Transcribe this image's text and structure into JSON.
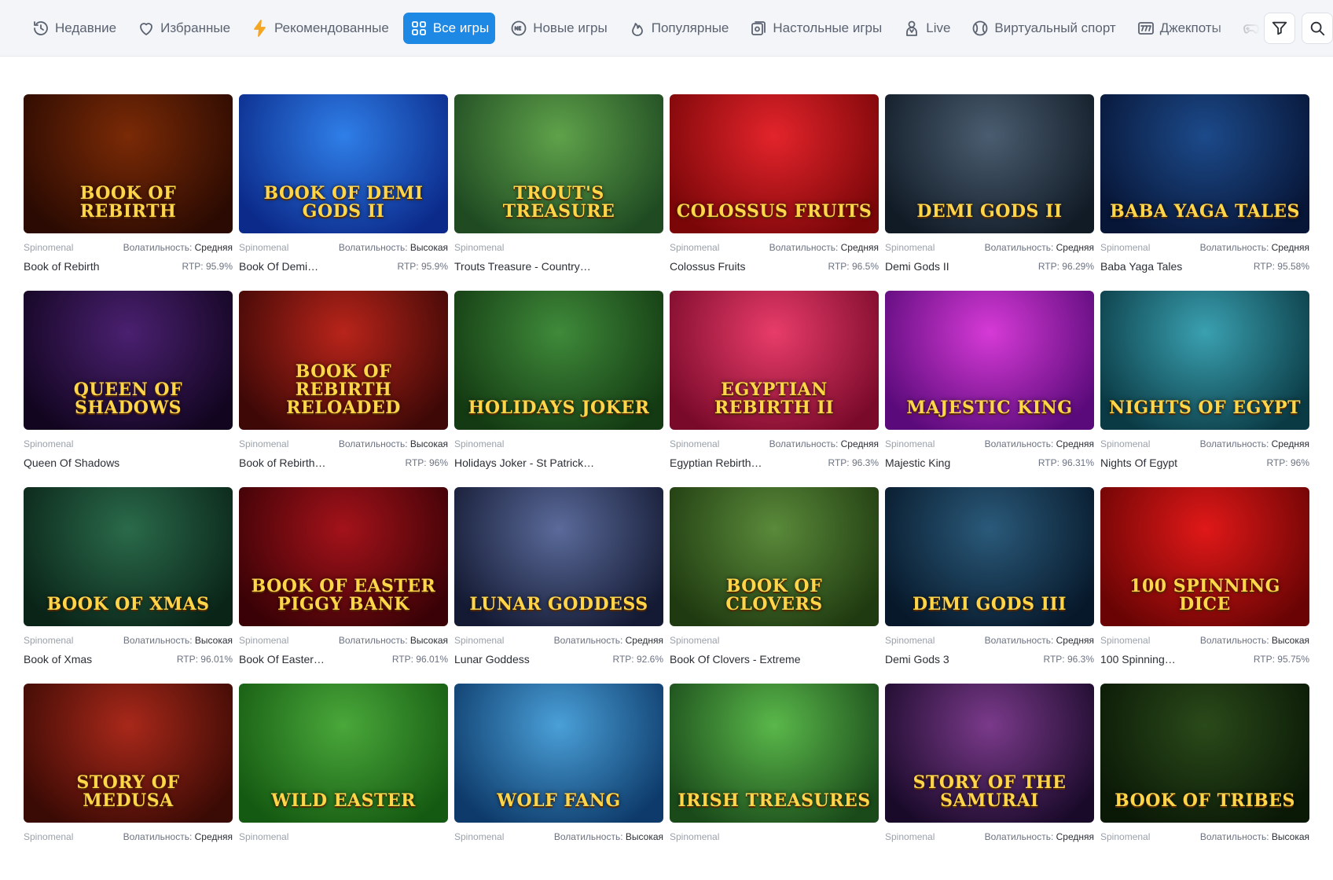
{
  "nav": {
    "tabs": [
      {
        "label": "Недавние",
        "icon": "history-icon"
      },
      {
        "label": "Избранные",
        "icon": "heart-icon"
      },
      {
        "label": "Рекомендованные",
        "icon": "lightning-icon"
      },
      {
        "label": "Все игры",
        "icon": "grid-icon",
        "active": true
      },
      {
        "label": "Новые игры",
        "icon": "new-badge-icon"
      },
      {
        "label": "Популярные",
        "icon": "flame-icon"
      },
      {
        "label": "Настольные игры",
        "icon": "chip-icon"
      },
      {
        "label": "Live",
        "icon": "dealer-icon"
      },
      {
        "label": "Виртуальный спорт",
        "icon": "ball-icon"
      },
      {
        "label": "Джекпоты",
        "icon": "777-icon"
      },
      {
        "label": "Други",
        "icon": "gamepad-icon"
      }
    ],
    "filter_icon": "filter-icon",
    "search_icon": "search-icon"
  },
  "labels": {
    "volatility": "Волатильность: ",
    "rtp": "RTP: "
  },
  "games": [
    {
      "title": "Book of Rebirth",
      "art": "BOOK OF REBIRTH",
      "provider": "Spinomenal",
      "volatility": "Средняя",
      "rtp": "95.9%",
      "colors": [
        "#7a2a06",
        "#2a0a02"
      ]
    },
    {
      "title": "Book Of Demi…",
      "art": "BOOK OF DEMI GODS II",
      "provider": "Spinomenal",
      "volatility": "Высокая",
      "rtp": "95.9%",
      "colors": [
        "#2f7fe8",
        "#0b2a8a"
      ]
    },
    {
      "title": "Trouts Treasure - Countryside Quest",
      "art": "TROUT'S TREASURE",
      "provider": "Spinomenal",
      "volatility": "",
      "rtp": "",
      "colors": [
        "#5fa24a",
        "#1f4a22"
      ]
    },
    {
      "title": "Colossus Fruits",
      "art": "COLOSSUS FRUITS",
      "provider": "Spinomenal",
      "volatility": "Средняя",
      "rtp": "96.5%",
      "colors": [
        "#e3242b",
        "#7a0608"
      ]
    },
    {
      "title": "Demi Gods II",
      "art": "DEMI GODS II",
      "provider": "Spinomenal",
      "volatility": "Средняя",
      "rtp": "96.29%",
      "colors": [
        "#4a5d70",
        "#111b26"
      ]
    },
    {
      "title": "Baba Yaga Tales",
      "art": "BABA YAGA TALES",
      "provider": "Spinomenal",
      "volatility": "Средняя",
      "rtp": "95.58%",
      "colors": [
        "#1c4a8a",
        "#071536"
      ]
    },
    {
      "title": "Queen Of Shadows",
      "art": "QUEEN OF SHADOWS",
      "provider": "Spinomenal",
      "volatility": "",
      "rtp": "",
      "colors": [
        "#4a2070",
        "#120520"
      ]
    },
    {
      "title": "Book of Rebirth…",
      "art": "BOOK OF REBIRTH RELOADED",
      "provider": "Spinomenal",
      "volatility": "Высокая",
      "rtp": "96%",
      "colors": [
        "#b8241a",
        "#3d0806"
      ]
    },
    {
      "title": "Holidays Joker - St Patricks Day",
      "art": "HOLIDAYS JOKER",
      "provider": "Spinomenal",
      "volatility": "",
      "rtp": "",
      "colors": [
        "#3f8a3a",
        "#133a12"
      ]
    },
    {
      "title": "Egyptian Rebirth…",
      "art": "EGYPTIAN REBIRTH II",
      "provider": "Spinomenal",
      "volatility": "Средняя",
      "rtp": "96.3%",
      "colors": [
        "#e83c6a",
        "#7a0a2a"
      ]
    },
    {
      "title": "Majestic King",
      "art": "MAJESTIC KING",
      "provider": "Spinomenal",
      "volatility": "Средняя",
      "rtp": "96.31%",
      "colors": [
        "#d63ad6",
        "#5a0a7a"
      ]
    },
    {
      "title": "Nights Of Egypt",
      "art": "NIGHTS OF EGYPT",
      "provider": "Spinomenal",
      "volatility": "Средняя",
      "rtp": "96%",
      "colors": [
        "#3aa0b0",
        "#0a3a44"
      ]
    },
    {
      "title": "Book of Xmas",
      "art": "BOOK OF XMAS",
      "provider": "Spinomenal",
      "volatility": "Высокая",
      "rtp": "96.01%",
      "colors": [
        "#2a6a4a",
        "#0a2418"
      ]
    },
    {
      "title": "Book Of Easter…",
      "art": "BOOK OF EASTER PIGGY BANK",
      "provider": "Spinomenal",
      "volatility": "Высокая",
      "rtp": "96.01%",
      "colors": [
        "#a4121a",
        "#3a0206"
      ]
    },
    {
      "title": "Lunar Goddess",
      "art": "LUNAR GODDESS",
      "provider": "Spinomenal",
      "volatility": "Средняя",
      "rtp": "92.6%",
      "colors": [
        "#5a6a9a",
        "#141a33"
      ]
    },
    {
      "title": "Book Of Clovers - Extreme",
      "art": "BOOK OF CLOVERS",
      "provider": "Spinomenal",
      "volatility": "",
      "rtp": "",
      "colors": [
        "#5a8a3a",
        "#1f3a10"
      ]
    },
    {
      "title": "Demi Gods 3",
      "art": "DEMI GODS III",
      "provider": "Spinomenal",
      "volatility": "Средняя",
      "rtp": "96.3%",
      "colors": [
        "#2a5a7a",
        "#07182a"
      ]
    },
    {
      "title": "100 Spinning…",
      "art": "100 SPINNING DICE",
      "provider": "Spinomenal",
      "volatility": "Высокая",
      "rtp": "95.75%",
      "colors": [
        "#e01818",
        "#6a0404"
      ]
    },
    {
      "title": "",
      "art": "STORY OF MEDUSA",
      "provider": "Spinomenal",
      "volatility": "Средняя",
      "rtp": "",
      "colors": [
        "#a8281a",
        "#3a0a04"
      ]
    },
    {
      "title": "",
      "art": "WILD EASTER",
      "provider": "Spinomenal",
      "volatility": "",
      "rtp": "",
      "colors": [
        "#4aa83a",
        "#155a12"
      ]
    },
    {
      "title": "",
      "art": "WOLF FANG",
      "provider": "Spinomenal",
      "volatility": "Высокая",
      "rtp": "",
      "colors": [
        "#4aa0d8",
        "#0d3a6a"
      ]
    },
    {
      "title": "",
      "art": "IRISH TREASURES",
      "provider": "Spinomenal",
      "volatility": "",
      "rtp": "",
      "colors": [
        "#5ab84a",
        "#1a4a1a"
      ]
    },
    {
      "title": "",
      "art": "STORY OF THE SAMURAI",
      "provider": "Spinomenal",
      "volatility": "Средняя",
      "rtp": "",
      "colors": [
        "#7a3a8a",
        "#1a0a2a"
      ]
    },
    {
      "title": "",
      "art": "BOOK OF TRIBES",
      "provider": "Spinomenal",
      "volatility": "Высокая",
      "rtp": "",
      "colors": [
        "#2a4a1a",
        "#0a1806"
      ]
    }
  ]
}
